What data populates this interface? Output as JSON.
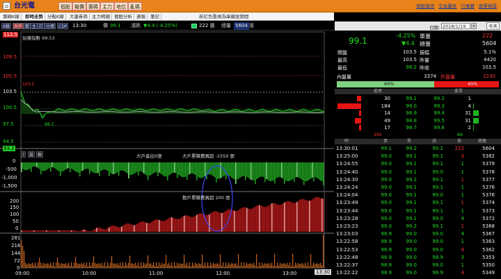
{
  "header": {
    "ticker": "台光電",
    "tabs": [
      "個股",
      "報價",
      "籌碼",
      "主力",
      "地位",
      "亂碼"
    ],
    "links": [
      "個股資訊",
      "交易屬性",
      "行事曆",
      "股票搜尋"
    ]
  },
  "subtabs": {
    "items": [
      "籌碼K線",
      "即時走勢",
      "分點K線",
      "大量券商",
      "主力明細",
      "個股分析",
      "週報",
      "筆記"
    ],
    "notice": "新紅色重規為庫藏股期間"
  },
  "toolbar": {
    "buttons": [
      "K線",
      "大戶",
      "散",
      "主",
      "訂",
      "分價",
      "CDP"
    ],
    "time": "13:30",
    "price_label": "價",
    "price_value": "99.1",
    "change_label": "漲跌",
    "change_value": "▼4.4 (-4.25%)",
    "volume_value": "222 張",
    "total_label": "總量",
    "total_value": "5604",
    "total_unit": "張"
  },
  "chart": {
    "price_ticks": [
      "113.5",
      "109.5",
      "105.5",
      "103.5",
      "100.5",
      "97.5",
      "94.5",
      "93.2"
    ],
    "legend": "加權指數 99.53",
    "mid_label": "103.5",
    "low_label": "98.2",
    "panel1_tools": [
      "?",
      "設",
      "框"
    ],
    "panel1_title_a": "大戶進出0張",
    "panel1_title_b": "大戶累積賣買超 -1550 張",
    "panel1_ticks": [
      "0",
      "-500",
      "-1,000",
      "-1,500"
    ],
    "panel2_title": "散戶累積賣買超 200 張",
    "panel2_ticks": [
      "200",
      "150",
      "100",
      "50",
      "0"
    ],
    "panel3_ticks": [
      "281",
      "216",
      "144",
      "72",
      "0"
    ],
    "time_ticks": [
      "09:00",
      "10:00",
      "11:00",
      "12:00",
      "13:00"
    ],
    "time_now": "13:30"
  },
  "quote": {
    "date_label": "日期:",
    "date_value": "2018/1/19",
    "today_btn": "今天",
    "price": "99.1",
    "pct": "-4.25%",
    "chg": "▼4.4",
    "unit_vol_label": "單量",
    "unit_vol": "222",
    "total_vol_label": "總量",
    "total_vol": "5604",
    "rows": [
      [
        "開盤",
        "103.5",
        "振幅",
        "5.1%"
      ],
      [
        "最高",
        "103.5",
        "昨量",
        "4420"
      ],
      [
        "最低",
        "98.2",
        "昨收",
        "103.5"
      ]
    ],
    "inner_label": "內盤量",
    "inner_value": "3374",
    "outer_label": "外盤量",
    "outer_value": "2230",
    "buy_pct": "60%",
    "sell_pct": "40%",
    "book_head_buy": "委買",
    "book_head_sell": "委賣",
    "book": [
      {
        "bq": "30",
        "bp": "99.1",
        "sp": "99.2",
        "sq": "1"
      },
      {
        "bq": "184",
        "bp": "99.0",
        "sp": "99.3",
        "sq": "4"
      },
      {
        "bq": "14",
        "bp": "98.9",
        "sp": "99.4",
        "sq": "31"
      },
      {
        "bq": "49",
        "bp": "98.8",
        "sp": "99.5",
        "sq": "31"
      },
      {
        "bq": "17",
        "bp": "98.7",
        "sp": "99.6",
        "sq": "2"
      }
    ],
    "book_total_buy": "294",
    "book_total_sell": "69",
    "trade_headers": [
      "時",
      "買",
      "賣",
      "成",
      "單",
      "總量"
    ],
    "trades": [
      [
        "13:30:01",
        "99.1",
        "99.2",
        "99.1",
        "222",
        "5604"
      ],
      [
        "13:25:00",
        "99.0",
        "99.1",
        "99.1",
        "3",
        "5382"
      ],
      [
        "13:24:55",
        "99.0",
        "99.1",
        "99.1",
        "1",
        "5379"
      ],
      [
        "13:24:40",
        "99.0",
        "99.1",
        "99.0",
        "1",
        "5378"
      ],
      [
        "13:24:30",
        "99.0",
        "99.2",
        "99.1",
        "1",
        "5377"
      ],
      [
        "13:24:24",
        "99.0",
        "99.1",
        "99.1",
        "1",
        "5376"
      ],
      [
        "13:24:04",
        "99.0",
        "99.1",
        "99.0",
        "1",
        "5376"
      ],
      [
        "13:23:49",
        "99.0",
        "99.1",
        "99.1",
        "1",
        "5374"
      ],
      [
        "13:23:44",
        "99.0",
        "99.1",
        "99.1",
        "1",
        "5373"
      ],
      [
        "13:23:28",
        "99.0",
        "99.1",
        "99.0",
        "4",
        "5372"
      ],
      [
        "13:23:23",
        "99.0",
        "99.2",
        "99.1",
        "1",
        "5368"
      ],
      [
        "13:23:03",
        "98.9",
        "99.0",
        "99.0",
        "4",
        "5367"
      ],
      [
        "13:22:58",
        "98.9",
        "99.0",
        "99.0",
        "1",
        "5363"
      ],
      [
        "13:22:53",
        "98.9",
        "99.0",
        "99.0",
        "9",
        "5362"
      ],
      [
        "13:22:48",
        "98.9",
        "99.0",
        "98.9",
        "3",
        "5353"
      ],
      [
        "13:22:37",
        "98.9",
        "99.0",
        "99.0",
        "1",
        "5350"
      ],
      [
        "13:22:22",
        "98.9",
        "99.0",
        "98.9",
        "4",
        "5349"
      ]
    ]
  }
}
